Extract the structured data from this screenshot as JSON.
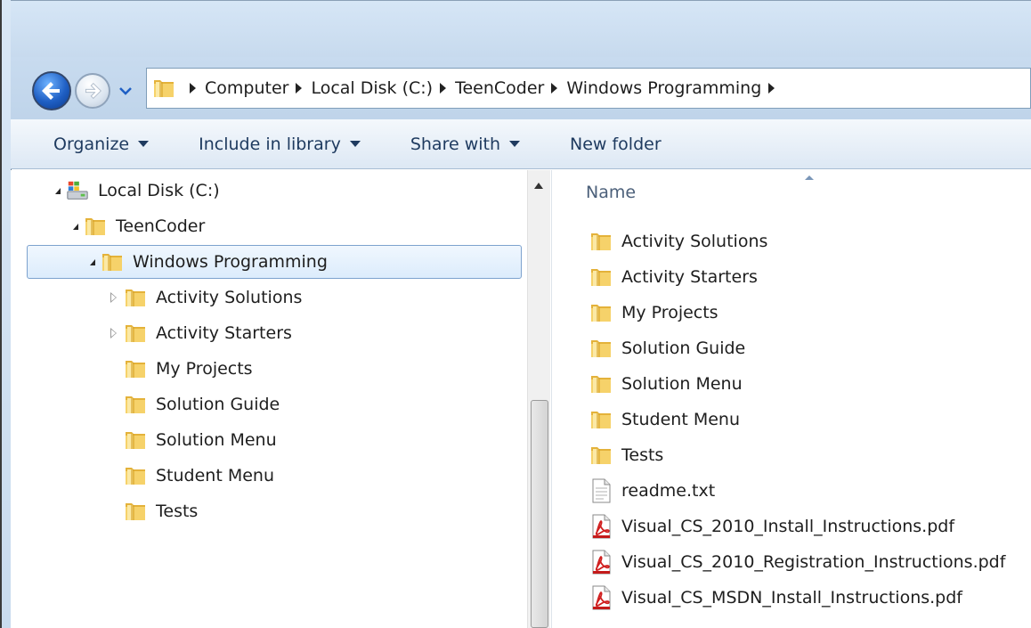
{
  "breadcrumb": [
    "Computer",
    "Local Disk (C:)",
    "TeenCoder",
    "Windows Programming"
  ],
  "toolbar": {
    "organize": "Organize",
    "include_in_library": "Include in library",
    "share_with": "Share with",
    "new_folder": "New folder"
  },
  "tree": {
    "local_disk": "Local Disk (C:)",
    "teencoder": "TeenCoder",
    "windows_programming": "Windows Programming",
    "children": [
      "Activity Solutions",
      "Activity Starters",
      "My Projects",
      "Solution Guide",
      "Solution Menu",
      "Student Menu",
      "Tests"
    ]
  },
  "content": {
    "column_name": "Name",
    "items": [
      {
        "name": "Activity Solutions",
        "icon": "folder-icon"
      },
      {
        "name": "Activity Starters",
        "icon": "folder-icon"
      },
      {
        "name": "My Projects",
        "icon": "folder-icon"
      },
      {
        "name": "Solution Guide",
        "icon": "folder-icon"
      },
      {
        "name": "Solution Menu",
        "icon": "folder-icon"
      },
      {
        "name": "Student Menu",
        "icon": "folder-icon"
      },
      {
        "name": "Tests",
        "icon": "folder-icon"
      },
      {
        "name": "readme.txt",
        "icon": "text-file-icon"
      },
      {
        "name": "Visual_CS_2010_Install_Instructions.pdf",
        "icon": "pdf-file-icon"
      },
      {
        "name": "Visual_CS_2010_Registration_Instructions.pdf",
        "icon": "pdf-file-icon"
      },
      {
        "name": "Visual_CS_MSDN_Install_Instructions.pdf",
        "icon": "pdf-file-icon"
      }
    ]
  },
  "colors": {
    "selection_border": "#7da2ce",
    "toolbar_text": "#1e3a5f",
    "folder_yellow": "#f2c74a"
  }
}
